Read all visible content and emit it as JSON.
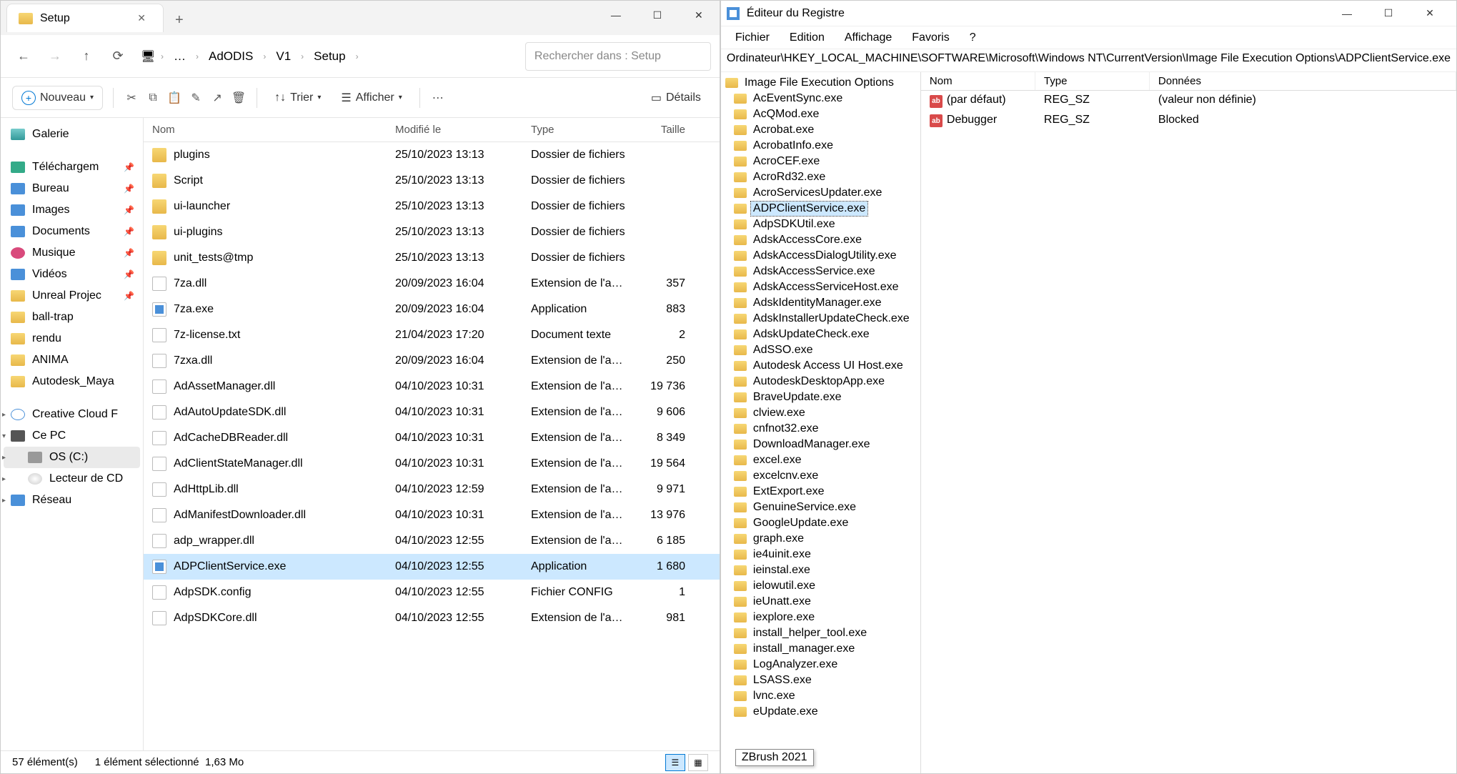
{
  "explorer": {
    "tab_title": "Setup",
    "search_placeholder": "Rechercher dans : Setup",
    "breadcrumb": [
      "…",
      "AdODIS",
      "V1",
      "Setup"
    ],
    "toolbar": {
      "new": "Nouveau",
      "sort": "Trier",
      "view": "Afficher",
      "details": "Détails"
    },
    "sidebar": [
      {
        "label": "Galerie",
        "icon": "ic-gallery"
      },
      {
        "label": "Téléchargem",
        "icon": "ic-dl",
        "pin": true
      },
      {
        "label": "Bureau",
        "icon": "ic-desktop",
        "pin": true
      },
      {
        "label": "Images",
        "icon": "ic-img",
        "pin": true
      },
      {
        "label": "Documents",
        "icon": "ic-doc",
        "pin": true
      },
      {
        "label": "Musique",
        "icon": "ic-music",
        "pin": true
      },
      {
        "label": "Vidéos",
        "icon": "ic-video",
        "pin": true
      },
      {
        "label": "Unreal Projec",
        "icon": "ic-folder",
        "pin": true
      },
      {
        "label": "ball-trap",
        "icon": "ic-folder"
      },
      {
        "label": "rendu",
        "icon": "ic-folder"
      },
      {
        "label": "ANIMA",
        "icon": "ic-folder"
      },
      {
        "label": "Autodesk_Maya",
        "icon": "ic-folder"
      },
      {
        "label": "Creative Cloud F",
        "icon": "ic-cloud",
        "chev": ">"
      },
      {
        "label": "Ce PC",
        "icon": "ic-pc",
        "chev": "v"
      },
      {
        "label": "OS (C:)",
        "icon": "ic-drive",
        "indent": true,
        "chev": ">",
        "selected": true
      },
      {
        "label": "Lecteur de CD",
        "icon": "ic-cd",
        "indent": true,
        "chev": ">"
      },
      {
        "label": "Réseau",
        "icon": "ic-network",
        "chev": ">"
      }
    ],
    "columns": {
      "name": "Nom",
      "modified": "Modifié le",
      "type": "Type",
      "size": "Taille"
    },
    "files": [
      {
        "name": "plugins",
        "mod": "25/10/2023 13:13",
        "type": "Dossier de fichiers",
        "size": "",
        "icon": "fi-folder"
      },
      {
        "name": "Script",
        "mod": "25/10/2023 13:13",
        "type": "Dossier de fichiers",
        "size": "",
        "icon": "fi-folder"
      },
      {
        "name": "ui-launcher",
        "mod": "25/10/2023 13:13",
        "type": "Dossier de fichiers",
        "size": "",
        "icon": "fi-folder"
      },
      {
        "name": "ui-plugins",
        "mod": "25/10/2023 13:13",
        "type": "Dossier de fichiers",
        "size": "",
        "icon": "fi-folder"
      },
      {
        "name": "unit_tests@tmp",
        "mod": "25/10/2023 13:13",
        "type": "Dossier de fichiers",
        "size": "",
        "icon": "fi-folder"
      },
      {
        "name": "7za.dll",
        "mod": "20/09/2023 16:04",
        "type": "Extension de l'app…",
        "size": "357",
        "icon": "fi-dll"
      },
      {
        "name": "7za.exe",
        "mod": "20/09/2023 16:04",
        "type": "Application",
        "size": "883",
        "icon": "fi-exe"
      },
      {
        "name": "7z-license.txt",
        "mod": "21/04/2023 17:20",
        "type": "Document texte",
        "size": "2",
        "icon": "fi-txt"
      },
      {
        "name": "7zxa.dll",
        "mod": "20/09/2023 16:04",
        "type": "Extension de l'app…",
        "size": "250",
        "icon": "fi-dll"
      },
      {
        "name": "AdAssetManager.dll",
        "mod": "04/10/2023 10:31",
        "type": "Extension de l'app…",
        "size": "19 736",
        "icon": "fi-dll"
      },
      {
        "name": "AdAutoUpdateSDK.dll",
        "mod": "04/10/2023 10:31",
        "type": "Extension de l'app…",
        "size": "9 606",
        "icon": "fi-dll"
      },
      {
        "name": "AdCacheDBReader.dll",
        "mod": "04/10/2023 10:31",
        "type": "Extension de l'app…",
        "size": "8 349",
        "icon": "fi-dll"
      },
      {
        "name": "AdClientStateManager.dll",
        "mod": "04/10/2023 10:31",
        "type": "Extension de l'app…",
        "size": "19 564",
        "icon": "fi-dll"
      },
      {
        "name": "AdHttpLib.dll",
        "mod": "04/10/2023 12:59",
        "type": "Extension de l'app…",
        "size": "9 971",
        "icon": "fi-dll"
      },
      {
        "name": "AdManifestDownloader.dll",
        "mod": "04/10/2023 10:31",
        "type": "Extension de l'app…",
        "size": "13 976",
        "icon": "fi-dll"
      },
      {
        "name": "adp_wrapper.dll",
        "mod": "04/10/2023 12:55",
        "type": "Extension de l'app…",
        "size": "6 185",
        "icon": "fi-dll"
      },
      {
        "name": "ADPClientService.exe",
        "mod": "04/10/2023 12:55",
        "type": "Application",
        "size": "1 680",
        "icon": "fi-exe",
        "selected": true
      },
      {
        "name": "AdpSDK.config",
        "mod": "04/10/2023 12:55",
        "type": "Fichier CONFIG",
        "size": "1",
        "icon": "fi-config"
      },
      {
        "name": "AdpSDKCore.dll",
        "mod": "04/10/2023 12:55",
        "type": "Extension de l'app…",
        "size": "981",
        "icon": "fi-dll"
      }
    ],
    "status": {
      "items": "57 élément(s)",
      "selected": "1 élément sélectionné",
      "size": "1,63 Mo"
    }
  },
  "registry": {
    "title": "Éditeur du Registre",
    "menu": [
      "Fichier",
      "Edition",
      "Affichage",
      "Favoris",
      "?"
    ],
    "path": "Ordinateur\\HKEY_LOCAL_MACHINE\\SOFTWARE\\Microsoft\\Windows NT\\CurrentVersion\\Image File Execution Options\\ADPClientService.exe",
    "tree_parent": "Image File Execution Options",
    "tree": [
      "AcEventSync.exe",
      "AcQMod.exe",
      "Acrobat.exe",
      "AcrobatInfo.exe",
      "AcroCEF.exe",
      "AcroRd32.exe",
      "AcroServicesUpdater.exe",
      "ADPClientService.exe",
      "AdpSDKUtil.exe",
      "AdskAccessCore.exe",
      "AdskAccessDialogUtility.exe",
      "AdskAccessService.exe",
      "AdskAccessServiceHost.exe",
      "AdskIdentityManager.exe",
      "AdskInstallerUpdateCheck.exe",
      "AdskUpdateCheck.exe",
      "AdSSO.exe",
      "Autodesk Access UI Host.exe",
      "AutodeskDesktopApp.exe",
      "BraveUpdate.exe",
      "clview.exe",
      "cnfnot32.exe",
      "DownloadManager.exe",
      "excel.exe",
      "excelcnv.exe",
      "ExtExport.exe",
      "GenuineService.exe",
      "GoogleUpdate.exe",
      "graph.exe",
      "ie4uinit.exe",
      "ieinstal.exe",
      "ielowutil.exe",
      "ieUnatt.exe",
      "iexplore.exe",
      "install_helper_tool.exe",
      "install_manager.exe",
      "LogAnalyzer.exe",
      "LSASS.exe",
      "lvnc.exe",
      "eUpdate.exe"
    ],
    "tree_selected": "ADPClientService.exe",
    "tooltip": "ZBrush 2021",
    "value_columns": {
      "name": "Nom",
      "type": "Type",
      "data": "Données"
    },
    "values": [
      {
        "name": "(par défaut)",
        "type": "REG_SZ",
        "data": "(valeur non définie)"
      },
      {
        "name": "Debugger",
        "type": "REG_SZ",
        "data": "Blocked"
      }
    ]
  }
}
